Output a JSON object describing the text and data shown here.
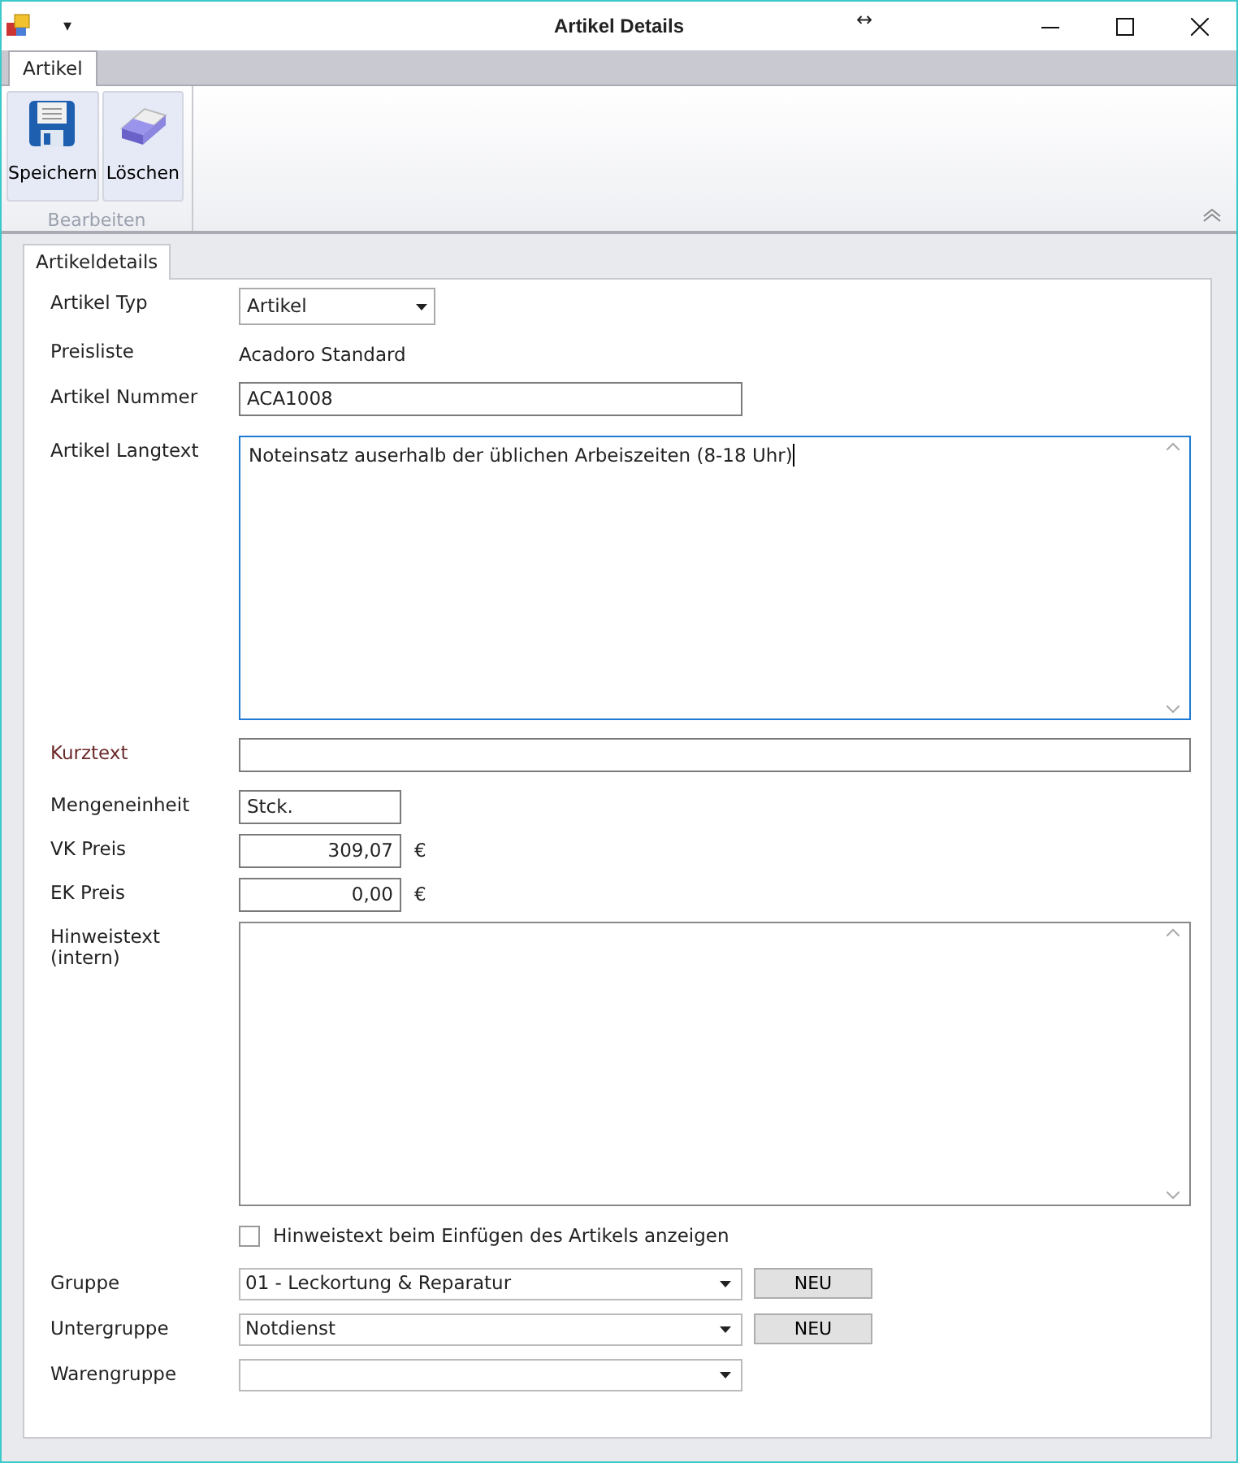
{
  "window": {
    "title": "Artikel Details",
    "quick_access": "▾",
    "resize_glyph": "↔"
  },
  "ribbon": {
    "tabs": [
      {
        "label": "Artikel",
        "selected": true
      }
    ],
    "buttons": [
      {
        "label": "Speichern",
        "kind": "save"
      },
      {
        "label": "Löschen",
        "kind": "erase"
      }
    ],
    "group_label": "Bearbeiten"
  },
  "form_tabs": [
    {
      "label": "Artikeldetails",
      "selected": true
    }
  ],
  "fields": [
    {
      "label": "Artikel Typ",
      "kind": "select",
      "value": "Artikel",
      "required": false
    },
    {
      "label": "Preisliste",
      "kind": "static",
      "value": "Acadoro Standard",
      "required": false
    },
    {
      "label": "Artikel Nummer",
      "kind": "input",
      "value": "ACA1008",
      "required": false
    },
    {
      "label": "Artikel Langtext",
      "kind": "textarea",
      "value": "Noteinsatz auserhalb der üblichen Arbeiszeiten (8-18 Uhr)",
      "focused": true,
      "required": false
    },
    {
      "label": "Kurztext",
      "kind": "input",
      "required": true
    },
    {
      "label": "Mengeneinheit",
      "kind": "short",
      "value": "Stck.",
      "required": false
    },
    {
      "label": "VK Preis",
      "kind": "money",
      "value": "309,07",
      "unit": "€",
      "required": false
    },
    {
      "label": "EK Preis",
      "kind": "money",
      "value": "0,00",
      "unit": "€",
      "required": false
    },
    {
      "label": "Hinweistext (intern)",
      "kind": "textarea",
      "focused": false,
      "required": false
    }
  ],
  "checkbox": {
    "label": "Hinweistext beim Einfügen des Artikels anzeigen",
    "checked": false
  },
  "groups": [
    {
      "label": "Gruppe",
      "value": "01 - Leckortung & Reparatur",
      "button": "NEU"
    },
    {
      "label": "Untergruppe",
      "value": "Notdienst",
      "button": "NEU"
    },
    {
      "label": "Warengruppe"
    }
  ]
}
